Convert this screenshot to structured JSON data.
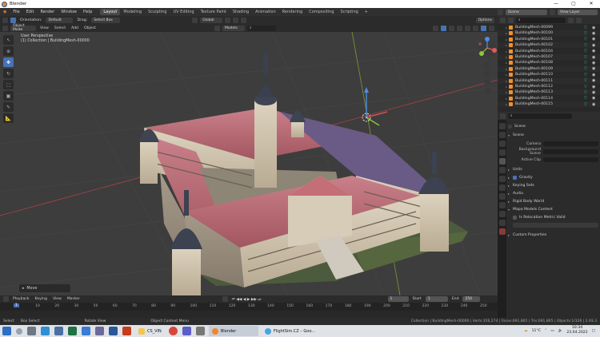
{
  "window": {
    "title": "Blender",
    "controls": [
      "—",
      "▢",
      "✕"
    ]
  },
  "menu": {
    "items": [
      "File",
      "Edit",
      "Render",
      "Window",
      "Help"
    ],
    "workspaces": [
      "Layout",
      "Modeling",
      "Sculpting",
      "UV Editing",
      "Texture Paint",
      "Shading",
      "Animation",
      "Rendering",
      "Compositing",
      "Scripting"
    ],
    "add_tab": "+",
    "scene_label": "Scene",
    "view_layer_label": "View Layer"
  },
  "viewport_header": {
    "mode": "Object Mode",
    "view": "View",
    "select": "Select",
    "add": "Add",
    "object": "Object",
    "orientation_label": "Orientation:",
    "orientation_value": "Default",
    "drag_label": "Drag:",
    "drag_value": "Select Box",
    "transform_space": "Global",
    "options": "Options",
    "models_label": "Models"
  },
  "viewport_info": {
    "line1": "User Perspective",
    "line2": "(1) Collection | BuildingMesh-00000"
  },
  "operator_panel": {
    "label": "Move"
  },
  "timeline": {
    "menus": [
      "Playback",
      "Keying",
      "View",
      "Marker"
    ],
    "current_frame": "1",
    "start_label": "Start",
    "start_value": "1",
    "end_label": "End",
    "end_value": "250",
    "ticks": [
      "0",
      "10",
      "20",
      "30",
      "50",
      "60",
      "70",
      "80",
      "90",
      "100",
      "110",
      "120",
      "130",
      "140",
      "150",
      "160",
      "170",
      "180",
      "190",
      "200",
      "210",
      "220",
      "230",
      "240",
      "250"
    ]
  },
  "outliner": {
    "search_placeholder": "",
    "rows": [
      "BuildingMesh-00099",
      "BuildingMesh-00100",
      "BuildingMesh-00101",
      "BuildingMesh-00102",
      "BuildingMesh-00104",
      "BuildingMesh-00107",
      "BuildingMesh-00108",
      "BuildingMesh-00109",
      "BuildingMesh-00110",
      "BuildingMesh-00111",
      "BuildingMesh-00112",
      "BuildingMesh-00113",
      "BuildingMesh-00114",
      "BuildingMesh-00115"
    ]
  },
  "properties": {
    "breadcrumb": "Scene",
    "scene_section": "Scene",
    "camera_label": "Camera",
    "background_scene_label": "Background Scene",
    "active_clip_label": "Active Clip",
    "sections": [
      "Units",
      "Gravity",
      "Keying Sets",
      "Audio",
      "Rigid Body World",
      "Mapa Models Content",
      "Custom Properties"
    ],
    "mapa_checkbox_label": "Is Relocation Metric Valid"
  },
  "statusbar": {
    "select": "Select",
    "box_select": "Box Select",
    "rotate_view": "Rotate View",
    "context_menu": "Object Context Menu",
    "stats": "Collection | BuildingMesh-00000 | Verts:356,274 | Faces:691,865 | Tris:691,865 | Objects:1/326 | 2.93.3"
  },
  "taskbar": {
    "apps": [
      {
        "label": "CS_VIN",
        "color": "#f2c74c"
      },
      {
        "label": "Blender",
        "color": "#f0852d"
      },
      {
        "label": "FlightSim.CZ – Goo...",
        "color": "#4aa3df"
      }
    ],
    "weather": "11°C",
    "time": "10:34",
    "date": "23.04.2022"
  },
  "colors": {
    "accent": "#4772b3",
    "grid_x": "#b0404a",
    "grid_y": "#7a9a32",
    "object_orange": "#f0902c",
    "mesh_green": "#38c07a"
  }
}
